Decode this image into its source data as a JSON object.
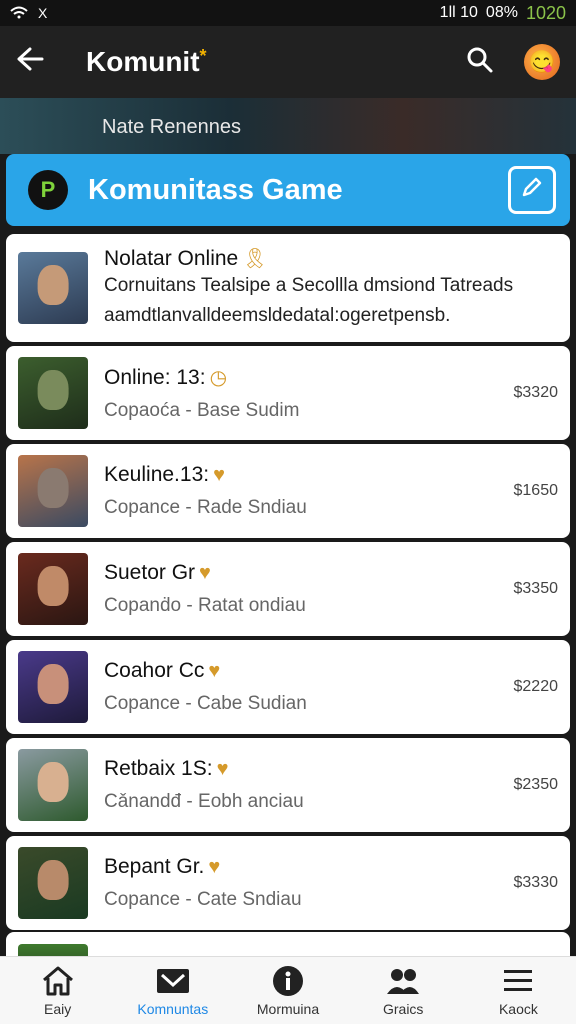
{
  "status_bar": {
    "left_icons": [
      "wifi-icon",
      "notification-icon"
    ],
    "notif_label": "X",
    "network": "1ll 10",
    "battery": "08%",
    "clock": "1020"
  },
  "app_bar": {
    "title": "Komunit",
    "star": "*",
    "back_icon": "arrow-left-icon",
    "search_icon": "search-icon",
    "avatar_icon": "emoji-avatar-icon"
  },
  "banner": {
    "label": "Nate Renennes"
  },
  "community": {
    "logo_letter": "P",
    "title": "Komunitass Game",
    "edit_icon": "edit-icon",
    "accent": "#2aa5e8"
  },
  "featured": {
    "title": "Nolatar Online",
    "badge": "🎗",
    "description": "Cornuitans Tealsipe a Secollla dmsiond Tatreads aamdtlanvalldeemsldedatal:ogeretpensb."
  },
  "games": [
    {
      "title": "Online: 13:",
      "badge": "◷",
      "sub_left": "Copaoća",
      "sub_right": "Base Sudim",
      "price": "$3320"
    },
    {
      "title": "Keuline.13:",
      "badge": "♥",
      "sub_left": "Copance",
      "sub_right": "Rade Sndiau",
      "price": "$1650"
    },
    {
      "title": "Suetor Gr",
      "badge": "♥",
      "sub_left": "Copanḋo",
      "sub_right": "Ratat ondiau",
      "price": "$3350"
    },
    {
      "title": "Coahor Cc",
      "badge": "♥",
      "sub_left": "Copance",
      "sub_right": "Cabe Sudian",
      "price": "$2220"
    },
    {
      "title": "Retbaix 1S:",
      "badge": "♥",
      "sub_left": "Cǎnandđ",
      "sub_right": "Eobh anciau",
      "price": "$2350"
    },
    {
      "title": "Bepant Gr.",
      "badge": "♥",
      "sub_left": "Copance",
      "sub_right": "Cate Sndiau",
      "price": "$3330"
    }
  ],
  "bottom_nav": [
    {
      "label": "Eaiy",
      "icon": "home-icon"
    },
    {
      "label": "Komnuntas",
      "icon": "community-icon",
      "active": true
    },
    {
      "label": "Mormuina",
      "icon": "info-icon"
    },
    {
      "label": "Graics",
      "icon": "users-icon"
    },
    {
      "label": "Kaock",
      "icon": "menu-icon"
    }
  ]
}
